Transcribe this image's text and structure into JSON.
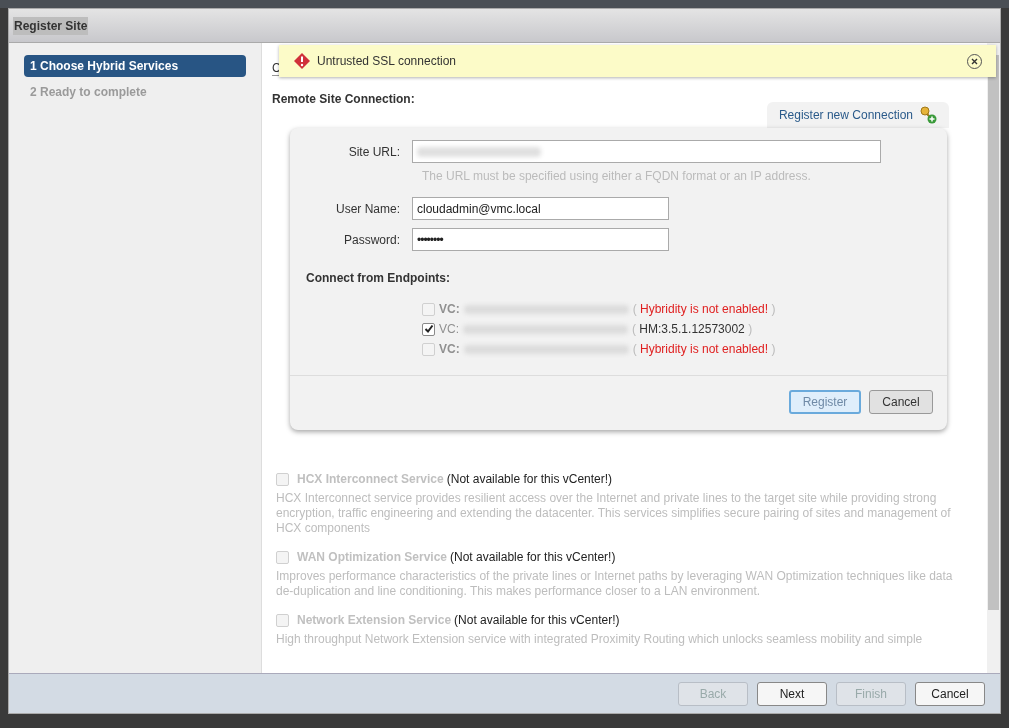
{
  "window": {
    "title": "Register Site"
  },
  "steps": [
    {
      "label": "1 Choose Hybrid Services",
      "selected": true
    },
    {
      "label": "2 Ready to complete",
      "selected": false
    }
  ],
  "alert": {
    "message": "Untrusted SSL connection"
  },
  "section_heading": "C",
  "remote": {
    "title": "Remote Site Connection:",
    "tab": "Register new Connection",
    "fields": [
      {
        "label": "Site URL:",
        "hint": "The URL must be specified using either a FQDN format or an IP address.",
        "kind": "redacted"
      },
      {
        "label": "User Name:",
        "value": "cloudadmin@vmc.local",
        "kind": "text"
      },
      {
        "label": "Password:",
        "value": "••••••••",
        "kind": "password"
      }
    ],
    "endpoints_title": "Connect from Endpoints:",
    "endpoints": [
      {
        "prefix": "VC:",
        "checked": false,
        "disabled": true,
        "open": "(",
        "status": "Hybridity is not enabled!",
        "close": ")",
        "kind": "error"
      },
      {
        "prefix": "VC:",
        "checked": true,
        "disabled": false,
        "open": "(",
        "status": "HM:3.5.1.12573002",
        "close": ")",
        "kind": "version"
      },
      {
        "prefix": "VC:",
        "checked": false,
        "disabled": true,
        "open": "(",
        "status": "Hybridity is not enabled!",
        "close": ")",
        "kind": "error"
      }
    ],
    "buttons": [
      {
        "label": "Register",
        "kind": "primary"
      },
      {
        "label": "Cancel",
        "kind": "default"
      }
    ]
  },
  "services": [
    {
      "name": "HCX Interconnect Service",
      "note": "(Not available for this vCenter!)",
      "checked": false,
      "disabled": true,
      "description": "HCX Interconnect service provides resilient access over the Internet and private lines to the target site while providing strong encryption, traffic engineering and extending the datacenter. This services simplifies secure pairing of sites and management of HCX components"
    },
    {
      "name": "WAN Optimization Service",
      "note": "(Not available for this vCenter!)",
      "checked": false,
      "disabled": true,
      "description": "Improves performance characteristics of the private lines or Internet paths by leveraging WAN Optimization techniques like data de-duplication and line conditioning. This makes performance closer to a LAN environment."
    },
    {
      "name": "Network Extension Service",
      "note": "(Not available for this vCenter!)",
      "checked": false,
      "disabled": true,
      "description": "High throughput Network Extension service with integrated Proximity Routing which unlocks seamless mobility and simple"
    }
  ],
  "footer_buttons": [
    {
      "label": "Back",
      "disabled": true
    },
    {
      "label": "Next",
      "disabled": false
    },
    {
      "label": "Finish",
      "disabled": true
    },
    {
      "label": "Cancel",
      "disabled": false
    }
  ]
}
